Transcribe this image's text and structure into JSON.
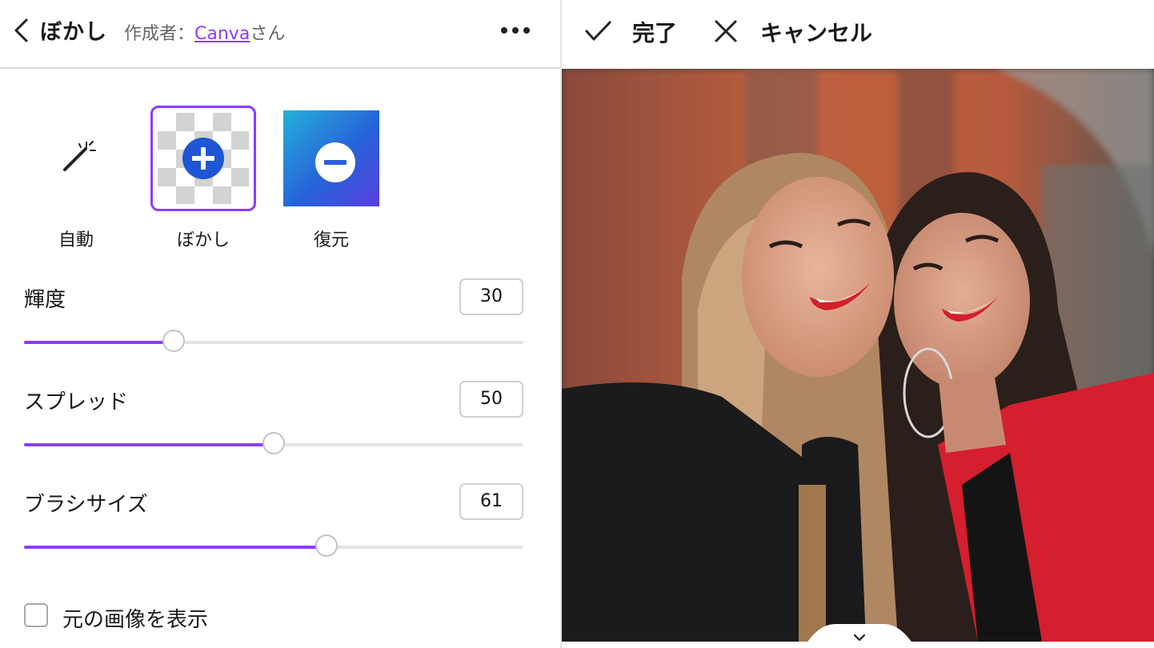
{
  "header": {
    "title": "ぼかし",
    "author_prefix": "作成者：",
    "author_link": "Canva",
    "author_suffix": "さん",
    "back_icon": "chevron-left-icon",
    "more_icon": "more-horizontal-icon"
  },
  "tools": [
    {
      "label": "自動",
      "icon": "magic-wand-icon",
      "selected": false
    },
    {
      "label": "ぼかし",
      "icon": "plus-circle-icon",
      "selected": true
    },
    {
      "label": "復元",
      "icon": "minus-circle-icon",
      "selected": false
    }
  ],
  "sliders": {
    "brightness": {
      "label": "輝度",
      "value": "30",
      "fraction": 0.3
    },
    "spread": {
      "label": "スプレッド",
      "value": "50",
      "fraction": 0.5
    },
    "brush_size": {
      "label": "ブラシサイズ",
      "value": "61",
      "fraction": 0.605
    }
  },
  "show_original": {
    "label": "元の画像を表示",
    "checked": false
  },
  "topbar": {
    "done_label": "完了",
    "done_icon": "check-icon",
    "cancel_label": "キャンセル",
    "cancel_icon": "close-icon"
  },
  "colors": {
    "accent": "#8b3dff",
    "track": "#e3e3e6",
    "restore_gradient_start": "#27b0d8",
    "restore_gradient_end": "#5a3fe0"
  },
  "photo": {
    "icon": "photo-preview",
    "collapse_icon": "chevron-down-icon"
  }
}
